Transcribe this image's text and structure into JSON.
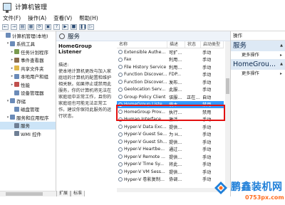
{
  "window": {
    "title": "计算机管理"
  },
  "menu": [
    "文件(F)",
    "操作(A)",
    "查看(V)",
    "帮助(H)"
  ],
  "toolbar": [
    "←",
    "→",
    "▤",
    "▦",
    "⟳",
    "▣",
    "?",
    "▶",
    "■",
    "❚❚",
    "▷"
  ],
  "tree": {
    "items": [
      {
        "label": "计算机管理(本地)",
        "level": 0,
        "arrow": "",
        "color": "#6b8bb8"
      },
      {
        "label": "系统工具",
        "level": 1,
        "arrow": "▾",
        "color": "#6b8bb8"
      },
      {
        "label": "任务计划程序",
        "level": 2,
        "arrow": "▸",
        "color": "#7a9b4e"
      },
      {
        "label": "事件查看器",
        "level": 2,
        "arrow": "▸",
        "color": "#8c6d4d"
      },
      {
        "label": "共享文件夹",
        "level": 2,
        "arrow": "▸",
        "color": "#e0b84a"
      },
      {
        "label": "本地用户和组",
        "level": 2,
        "arrow": "▸",
        "color": "#6b8bb8"
      },
      {
        "label": "性能",
        "level": 2,
        "arrow": "▸",
        "color": "#c0504d"
      },
      {
        "label": "设备管理器",
        "level": 2,
        "arrow": "",
        "color": "#6b8bb8"
      },
      {
        "label": "存储",
        "level": 1,
        "arrow": "▾",
        "color": "#6b8bb8"
      },
      {
        "label": "磁盘管理",
        "level": 2,
        "arrow": "",
        "color": "#6b8bb8"
      },
      {
        "label": "服务和应用程序",
        "level": 1,
        "arrow": "▾",
        "color": "#6b8bb8"
      },
      {
        "label": "服务",
        "level": 2,
        "arrow": "",
        "color": "#6f7f94",
        "selected": true
      },
      {
        "label": "WMI 控件",
        "level": 2,
        "arrow": "",
        "color": "#6f7f94"
      }
    ]
  },
  "center": {
    "header": "服务",
    "selected_service": "HomeGroup Listener",
    "desc_label": "描述:",
    "desc_text": "使本地计算机更改与加入家庭组的计算机的配置和维护相关联。如果停止或禁用此服务，你的计算机将无法在家庭组中正常工作，且你的家庭组也可能无法正常工作。建议你保持此服务的运行状态。",
    "columns": [
      "名称",
      "描述",
      "状态",
      "启动类型"
    ],
    "rows": [
      {
        "name": "Extensible Authe...",
        "desc": "可扩...",
        "state": "",
        "start": "手动"
      },
      {
        "name": "Fax",
        "desc": "利用...",
        "state": "",
        "start": "手动"
      },
      {
        "name": "File History Service",
        "desc": "利用...",
        "state": "",
        "start": "手动"
      },
      {
        "name": "Function Discover...",
        "desc": "FDP...",
        "state": "",
        "start": "手动"
      },
      {
        "name": "Function Discover...",
        "desc": "发布...",
        "state": "",
        "start": "手动"
      },
      {
        "name": "Geolocation Serv...",
        "desc": "此服...",
        "state": "",
        "start": "手动"
      },
      {
        "name": "Group Policy Client",
        "desc": "该服...",
        "state": "正在...",
        "start": "自动"
      },
      {
        "name": "HomeGroup Liste...",
        "desc": "使本...",
        "state": "",
        "start": "禁用",
        "selected": true
      },
      {
        "name": "HomeGroup Prov...",
        "desc": "执行...",
        "state": "",
        "start": "禁用"
      },
      {
        "name": "Human Interface ...",
        "desc": "激活...",
        "state": "",
        "start": "手动"
      },
      {
        "name": "Hyper-V Data Exc...",
        "desc": "提供...",
        "state": "",
        "start": "手动"
      },
      {
        "name": "Hyper-V Guest Se...",
        "desc": "为 H...",
        "state": "",
        "start": "手动"
      },
      {
        "name": "Hyper-V Guest Sh...",
        "desc": "提供...",
        "state": "",
        "start": "手动"
      },
      {
        "name": "Hyper-V Heartbe...",
        "desc": "通过...",
        "state": "",
        "start": "手动"
      },
      {
        "name": "Hyper-V Remote ...",
        "desc": "提供...",
        "state": "",
        "start": "手动"
      },
      {
        "name": "Hyper-V Time Sy...",
        "desc": "将此...",
        "state": "",
        "start": "手动"
      },
      {
        "name": "Hyper-V VM Sess...",
        "desc": "提供...",
        "state": "",
        "start": "手动"
      },
      {
        "name": "Hyper-V 卷影复制...",
        "desc": "协调...",
        "state": "",
        "start": "手动"
      }
    ],
    "tabs": [
      "扩展",
      "标准"
    ]
  },
  "actions": {
    "header": "操作",
    "groups": [
      {
        "title": "服务",
        "more": "更多操作"
      },
      {
        "title": "HomeGrou...",
        "more": "更多操作"
      }
    ]
  },
  "watermark": {
    "brand": "鹏鑫装机网",
    "url": "0753px.com"
  },
  "colors": {
    "selection": "#3399ff",
    "highlight_box": "#e21010",
    "actions_group": "#dde9f5"
  }
}
